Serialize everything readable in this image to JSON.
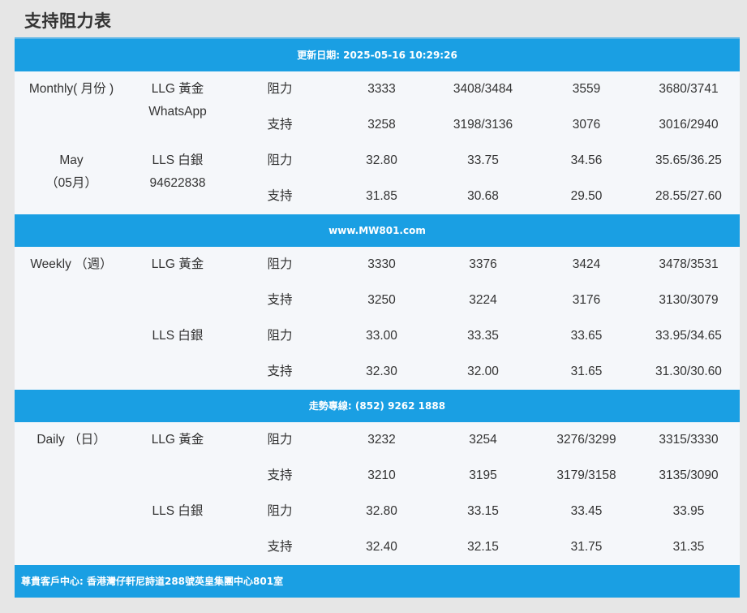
{
  "title": "支持阻力表",
  "banners": {
    "update": "更新日期: 2025-05-16 10:29:26",
    "website": "www.MW801.com",
    "hotline": "走勢專線: (852) 9262 1888",
    "address": "尊貴客戶中心: 香港灣仔軒尼詩道288號英皇集團中心801室"
  },
  "labels": {
    "resistance": "阻力",
    "support": "支持"
  },
  "monthly": {
    "period_line1": "Monthly( 月份 )",
    "period_line2": "May",
    "period_line3": "（05月）",
    "gold_label": "LLG 黃金",
    "gold_sub": "WhatsApp",
    "silver_label": "LLS 白銀",
    "silver_sub": "94622838",
    "gold_resistance": [
      "3333",
      "3408/3484",
      "3559",
      "3680/3741"
    ],
    "gold_support": [
      "3258",
      "3198/3136",
      "3076",
      "3016/2940"
    ],
    "silver_resistance": [
      "32.80",
      "33.75",
      "34.56",
      "35.65/36.25"
    ],
    "silver_support": [
      "31.85",
      "30.68",
      "29.50",
      "28.55/27.60"
    ]
  },
  "weekly": {
    "period_line1": "Weekly （週）",
    "gold_label": "LLG 黃金",
    "silver_label": "LLS 白銀",
    "gold_resistance": [
      "3330",
      "3376",
      "3424",
      "3478/3531"
    ],
    "gold_support": [
      "3250",
      "3224",
      "3176",
      "3130/3079"
    ],
    "silver_resistance": [
      "33.00",
      "33.35",
      "33.65",
      "33.95/34.65"
    ],
    "silver_support": [
      "32.30",
      "32.00",
      "31.65",
      "31.30/30.60"
    ]
  },
  "daily": {
    "period_line1": "Daily （日）",
    "gold_label": "LLG 黃金",
    "silver_label": "LLS 白銀",
    "gold_resistance": [
      "3232",
      "3254",
      "3276/3299",
      "3315/3330"
    ],
    "gold_support": [
      "3210",
      "3195",
      "3179/3158",
      "3135/3090"
    ],
    "silver_resistance": [
      "32.80",
      "33.15",
      "33.45",
      "33.95"
    ],
    "silver_support": [
      "32.40",
      "32.15",
      "31.75",
      "31.35"
    ]
  },
  "colors": {
    "banner": "#1a9fe3",
    "row_bg": "#f5f7fa",
    "page_bg": "#e6e6e6"
  }
}
